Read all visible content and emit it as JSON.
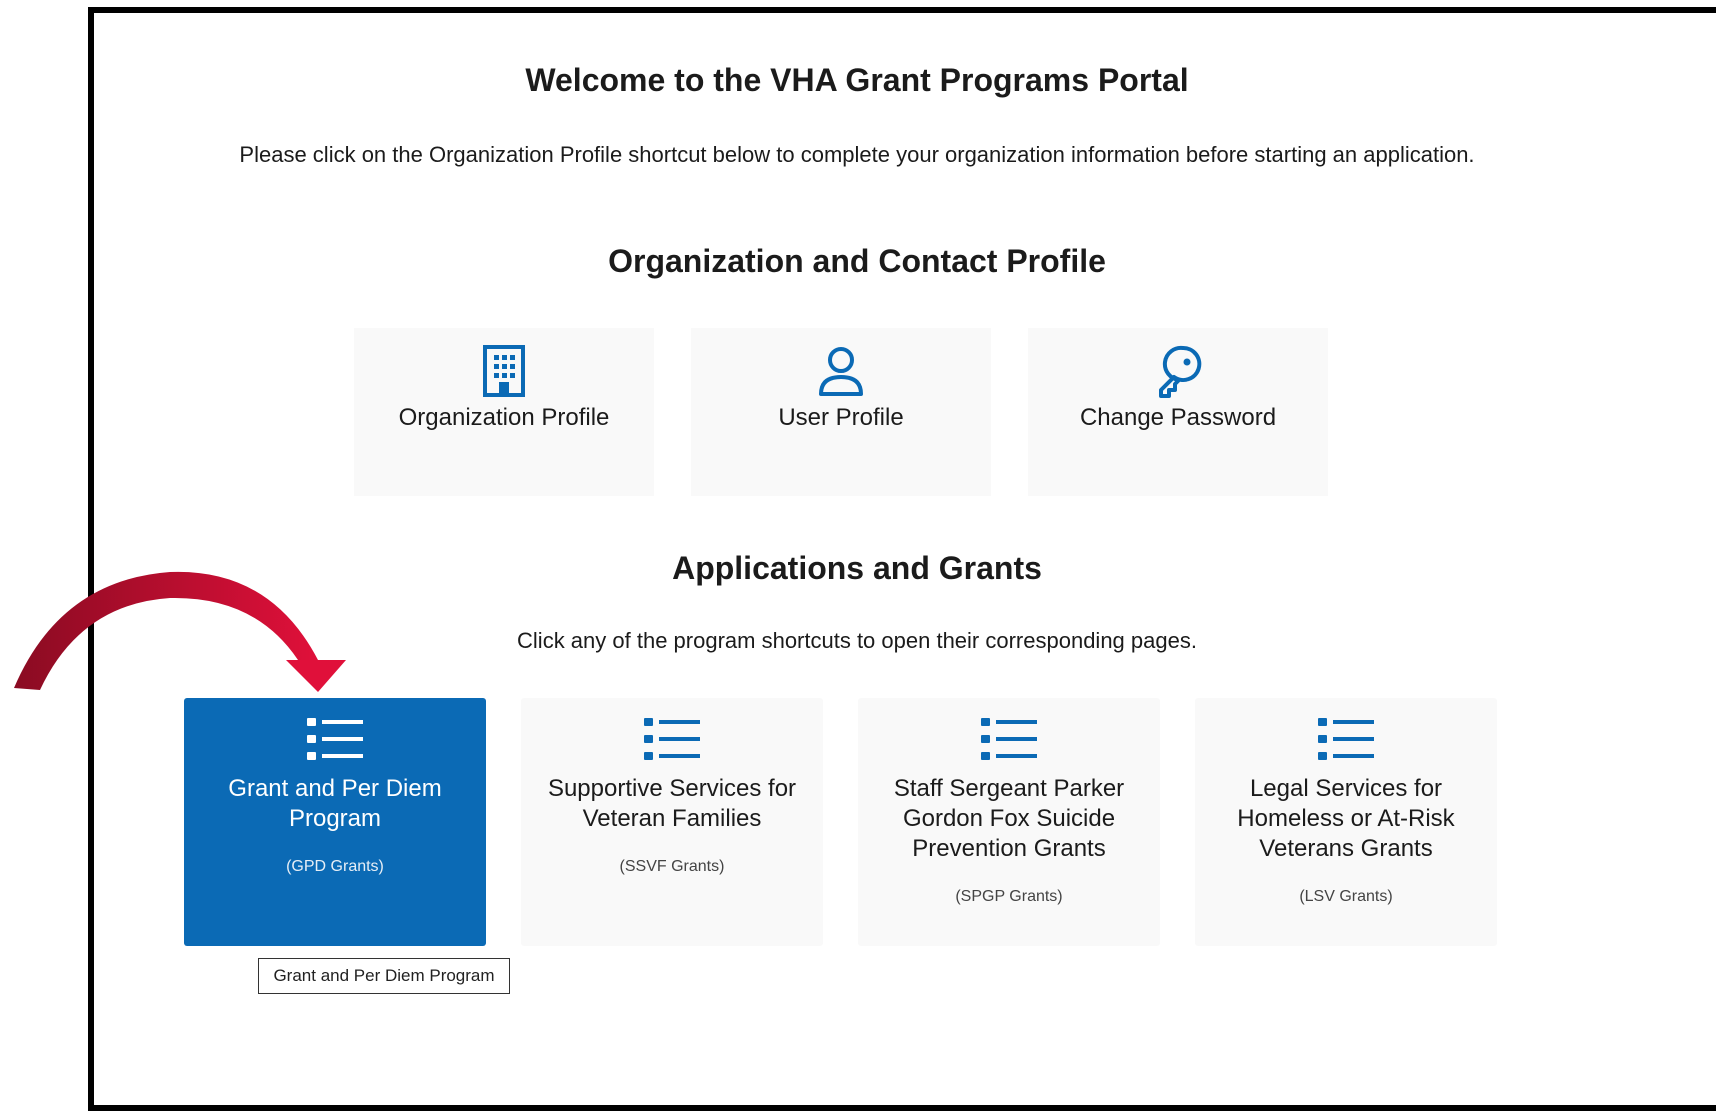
{
  "header": {
    "title": "Welcome to the VHA Grant Programs Portal",
    "intro": "Please click on the Organization Profile shortcut below to complete your organization information before starting an application."
  },
  "profile_section": {
    "heading": "Organization and Contact Profile",
    "cards": [
      {
        "label": "Organization Profile",
        "icon": "building-icon"
      },
      {
        "label": "User Profile",
        "icon": "user-icon"
      },
      {
        "label": "Change Password",
        "icon": "key-icon"
      }
    ]
  },
  "applications_section": {
    "heading": "Applications and Grants",
    "subtext": "Click any of the program shortcuts to open their corresponding pages.",
    "programs": [
      {
        "title": "Grant and Per Diem Program",
        "code": "(GPD Grants)",
        "icon": "list-icon",
        "active": true
      },
      {
        "title": "Supportive Services for Veteran Families",
        "code": "(SSVF Grants)",
        "icon": "list-icon",
        "active": false
      },
      {
        "title": "Staff Sergeant Parker Gordon Fox Suicide Prevention Grants",
        "code": "(SPGP Grants)",
        "icon": "list-icon",
        "active": false
      },
      {
        "title": "Legal Services for Homeless or At-Risk Veterans Grants",
        "code": "(LSV Grants)",
        "icon": "list-icon",
        "active": false
      }
    ]
  },
  "tooltip": {
    "text": "Grant and Per Diem Program"
  },
  "colors": {
    "active_card": "#0b6ab5",
    "icon_blue": "#0b6ab5",
    "arrow": "#c8102e"
  }
}
